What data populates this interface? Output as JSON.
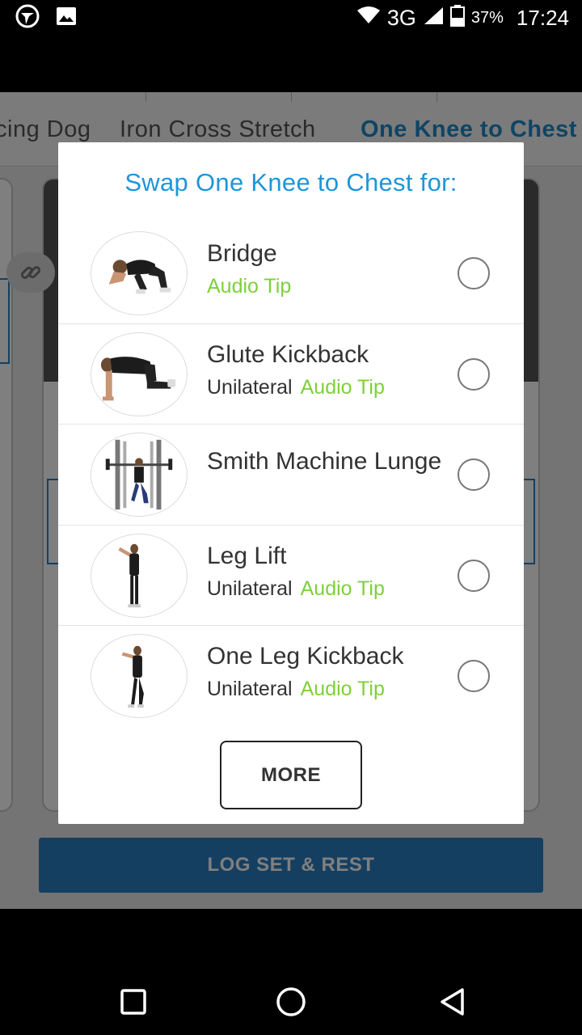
{
  "status_bar": {
    "network": "3G",
    "battery_percent": "37%",
    "time": "17:24"
  },
  "background": {
    "tabs": [
      {
        "label": "cing Dog",
        "active": false
      },
      {
        "label": "Iron Cross Stretch",
        "active": false
      },
      {
        "label": "One Knee to Chest",
        "active": true
      }
    ],
    "log_button_label": "LOG SET & REST"
  },
  "dialog": {
    "title": "Swap One Knee to Chest for:",
    "items": [
      {
        "name": "Bridge",
        "unilateral": "",
        "audio_tip": "Audio Tip",
        "selected": false
      },
      {
        "name": "Glute Kickback",
        "unilateral": "Unilateral",
        "audio_tip": "Audio Tip",
        "selected": false
      },
      {
        "name": "Smith Machine Lunge",
        "unilateral": "",
        "audio_tip": "",
        "selected": false
      },
      {
        "name": "Leg Lift",
        "unilateral": "Unilateral",
        "audio_tip": "Audio Tip",
        "selected": false
      },
      {
        "name": "One Leg Kickback",
        "unilateral": "Unilateral",
        "audio_tip": "Audio Tip",
        "selected": false
      }
    ],
    "more_label": "MORE"
  },
  "colors": {
    "title_blue": "#1e96d8",
    "audio_tip_green": "#7ed03a",
    "log_button_blue": "#2b7fc2"
  }
}
